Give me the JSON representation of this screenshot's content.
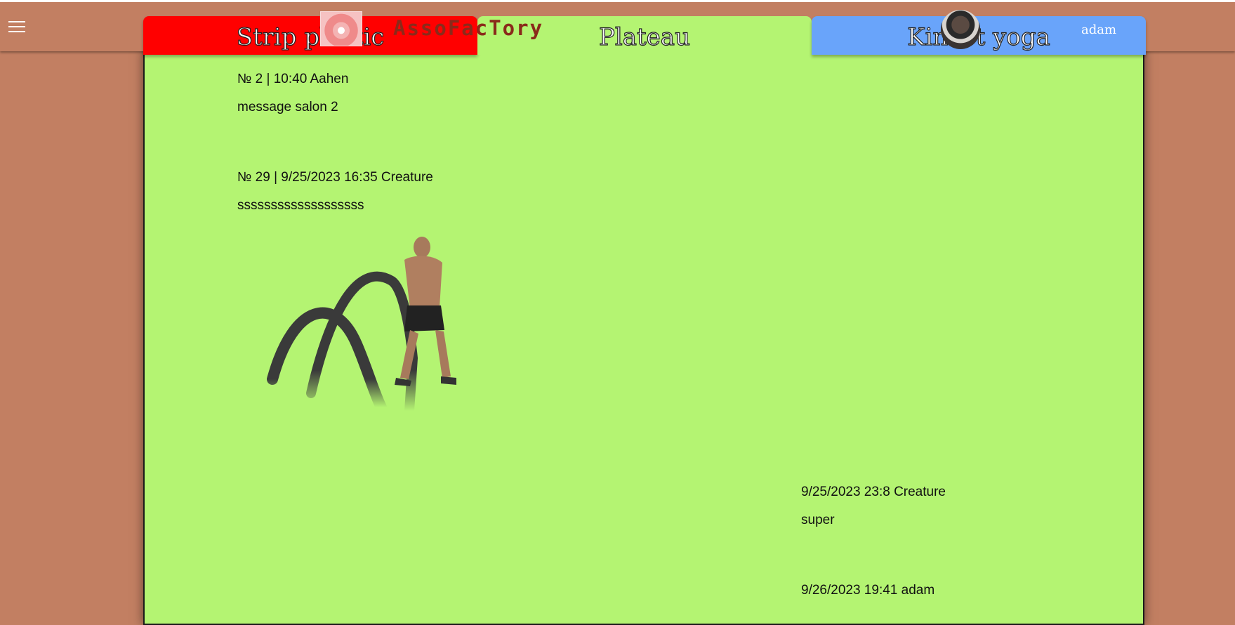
{
  "header": {
    "logo_text": "AssoFacTory",
    "username": "adam",
    "tabs": [
      {
        "label": "Strip plastic",
        "color": "#ff0000"
      },
      {
        "label": "Plateau",
        "color": "#b4f472"
      },
      {
        "label": "Kinect yoga",
        "color": "#69a4fa"
      }
    ]
  },
  "messages": [
    {
      "meta": "№ 2 | 10:40 Aahen",
      "body": "message salon 2"
    },
    {
      "meta": "№ 29 | 9/25/2023 16:35 Creature",
      "body": "sssssssssssssssssss",
      "image": "battle-rope-athlete-photo"
    },
    {
      "meta": "9/25/2023 23:8 Creature",
      "body": "super"
    },
    {
      "meta": "9/26/2023 19:41 adam",
      "body": ""
    }
  ],
  "colors": {
    "background": "#c27f62",
    "panel": "#b4f472"
  }
}
